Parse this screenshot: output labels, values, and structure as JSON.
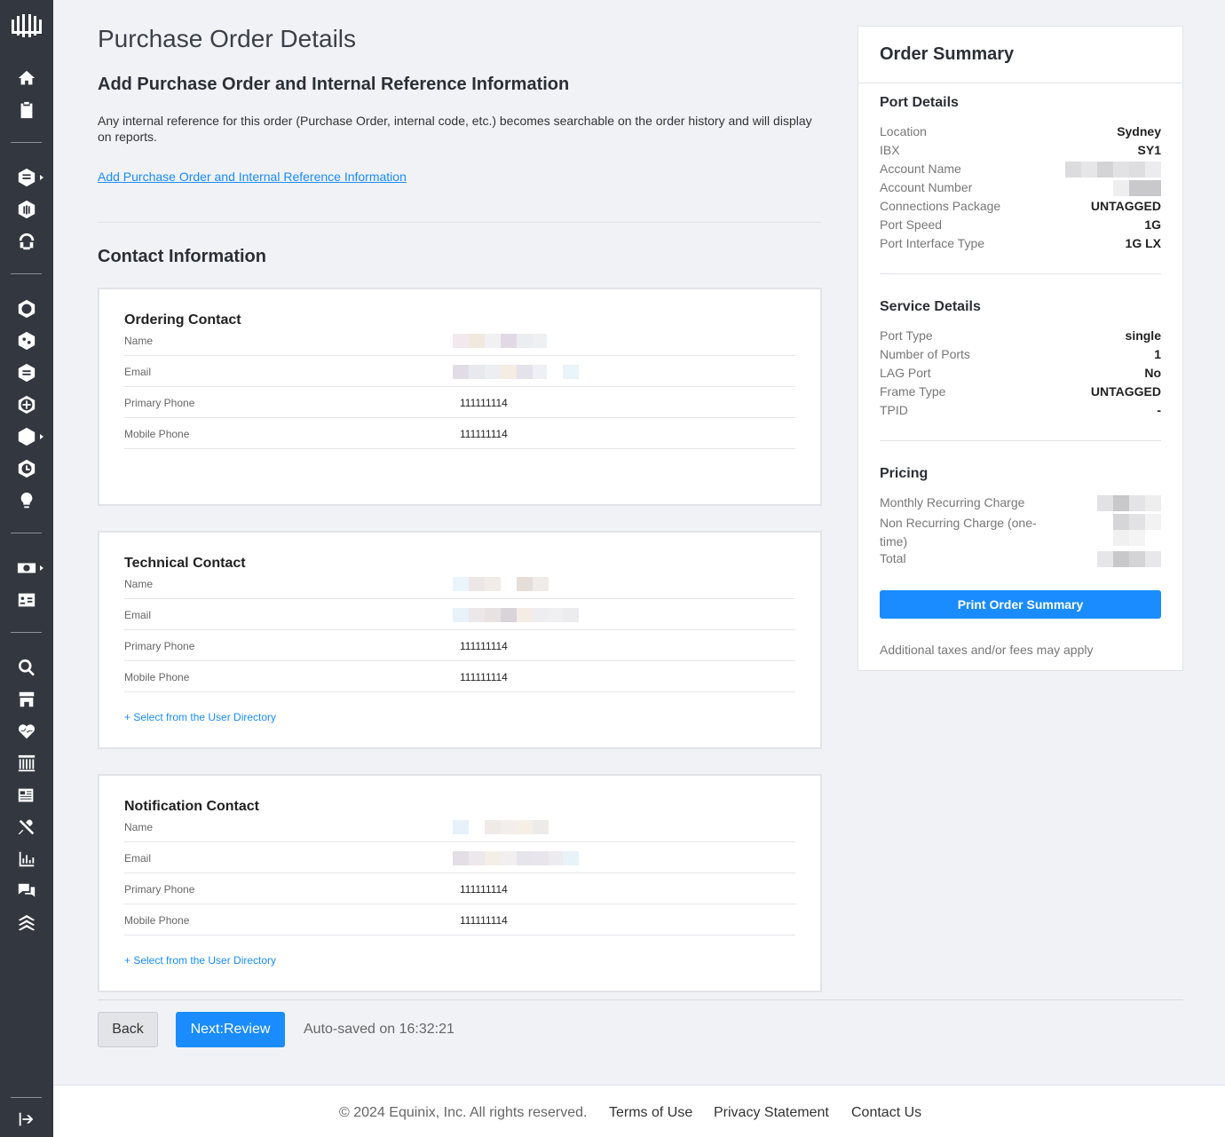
{
  "page": {
    "title": "Purchase Order Details",
    "po_heading": "Add Purchase Order and Internal Reference Information",
    "po_description": "Any internal reference for this order (Purchase Order, internal code, etc.) becomes searchable on the order history and will display on reports.",
    "po_link": "Add Purchase Order and Internal Reference Information",
    "contact_heading": "Contact Information"
  },
  "contacts": [
    {
      "title": "Ordering Contact",
      "fields": [
        {
          "label": "Name",
          "value": ""
        },
        {
          "label": "Email",
          "value": ""
        },
        {
          "label": "Primary Phone",
          "value": "111111114"
        },
        {
          "label": "Mobile Phone",
          "value": "111111114"
        }
      ],
      "select_link": ""
    },
    {
      "title": "Technical Contact",
      "fields": [
        {
          "label": "Name",
          "value": ""
        },
        {
          "label": "Email",
          "value": ""
        },
        {
          "label": "Primary Phone",
          "value": "111111114"
        },
        {
          "label": "Mobile Phone",
          "value": "111111114"
        }
      ],
      "select_link": "+ Select from the User Directory"
    },
    {
      "title": "Notification Contact",
      "fields": [
        {
          "label": "Name",
          "value": ""
        },
        {
          "label": "Email",
          "value": ""
        },
        {
          "label": "Primary Phone",
          "value": "111111114"
        },
        {
          "label": "Mobile Phone",
          "value": "111111114"
        }
      ],
      "select_link": "+ Select from the User Directory"
    }
  ],
  "actions": {
    "back_label": "Back",
    "next_label": "Next:Review",
    "autosave": "Auto-saved on 16:32:21"
  },
  "summary": {
    "title": "Order Summary",
    "port_details": {
      "heading": "Port Details",
      "rows": [
        {
          "key": "Location",
          "value": "Sydney"
        },
        {
          "key": "IBX",
          "value": "SY1"
        },
        {
          "key": "Account Name",
          "value": ""
        },
        {
          "key": "Account Number",
          "value": ""
        },
        {
          "key": "Connections Package",
          "value": "UNTAGGED"
        },
        {
          "key": "Port Speed",
          "value": "1G"
        },
        {
          "key": "Port Interface Type",
          "value": "1G LX"
        }
      ]
    },
    "service_details": {
      "heading": "Service Details",
      "rows": [
        {
          "key": "Port Type",
          "value": "single"
        },
        {
          "key": "Number of Ports",
          "value": "1"
        },
        {
          "key": "LAG Port",
          "value": "No"
        },
        {
          "key": "Frame Type",
          "value": "UNTAGGED"
        },
        {
          "key": "TPID",
          "value": "-"
        }
      ]
    },
    "pricing": {
      "heading": "Pricing",
      "monthly": "Monthly Recurring Charge",
      "non_recurring": "Non Recurring Charge (one-time)",
      "total": "Total"
    },
    "print_label": "Print Order Summary",
    "note": "Additional taxes and/or fees may apply"
  },
  "footer": {
    "copyright": "© 2024 Equinix, Inc. All rights reserved.",
    "terms": "Terms of Use",
    "privacy": "Privacy Statement",
    "contact": "Contact Us"
  },
  "colors": {
    "accent": "#1a8cff",
    "sidebar": "#33373f",
    "background": "#f1f2f6"
  },
  "sidebar_icons": [
    "home-icon",
    "clipboard-icon",
    "fabric-icon",
    "metal-icon",
    "support-icon",
    "network-edge-icon",
    "connect-icon",
    "fabric-cloud-icon",
    "globe-icon",
    "exchange-icon",
    "clock-icon",
    "bulb-icon",
    "billing-icon",
    "contacts-icon",
    "search-icon",
    "marketplace-icon",
    "health-icon",
    "library-icon",
    "news-icon",
    "tools-icon",
    "reports-icon",
    "chat-icon",
    "layers-icon",
    "logout-icon"
  ]
}
